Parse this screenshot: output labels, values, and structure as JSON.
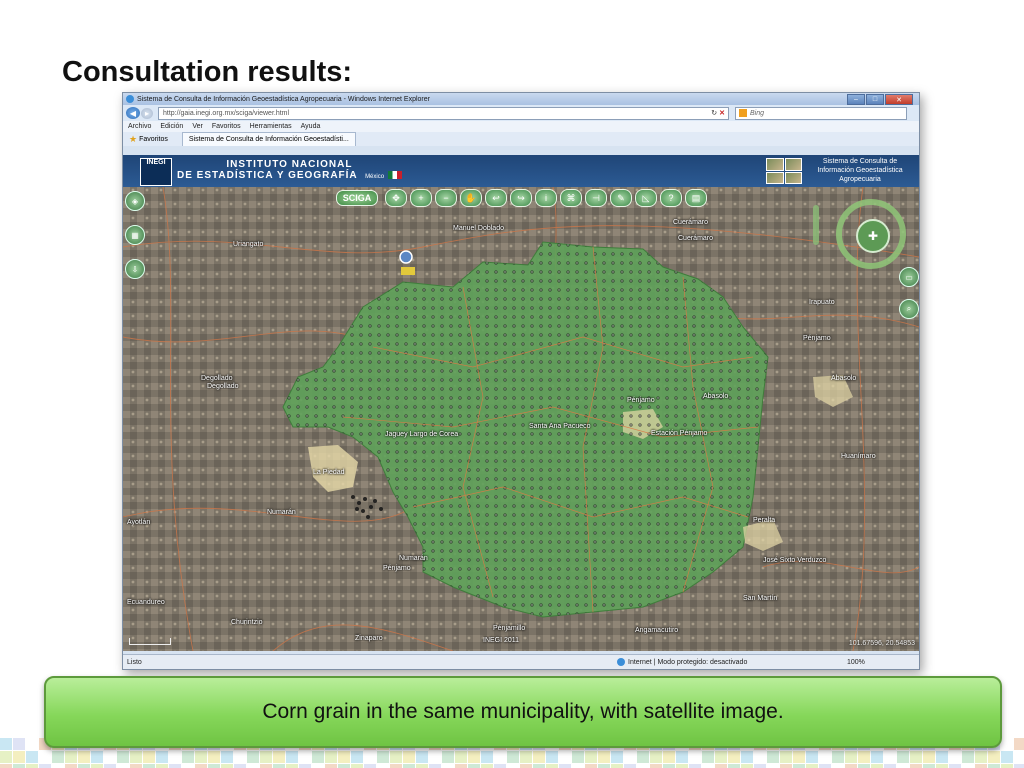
{
  "slide": {
    "title": "Consultation results:",
    "caption": "Corn grain in the same municipality, with satellite image."
  },
  "browser": {
    "window_title": "Sistema de Consulta de Información Geoestadística Agropecuaria - Windows Internet Explorer",
    "url": "http://gaia.inegi.org.mx/sciga/viewer.html",
    "search_placeholder": "Bing",
    "menu": [
      "Archivo",
      "Edición",
      "Ver",
      "Favoritos",
      "Herramientas",
      "Ayuda"
    ],
    "favorites_label": "Favoritos",
    "tab_label": "Sistema de Consulta de Información Geoestadísti...",
    "status_text": "Listo",
    "zone_text": "Internet | Modo protegido: desactivado",
    "zoom_text": "100%"
  },
  "app": {
    "logo_text": "INEGI",
    "institute_line1": "INSTITUTO NACIONAL",
    "institute_line2": "DE ESTADÍSTICA Y GEOGRAFÍA",
    "country": "México",
    "system_name_line1": "Sistema de Consulta de",
    "system_name_line2": "Información Geoestadística",
    "system_name_line3": "Agropecuaria",
    "toolbar_label": "SCIGA"
  },
  "map": {
    "places": [
      "Manuel Doblado",
      "Cuerámaro",
      "Cuerámaro",
      "Uriangato",
      "Pénjamo",
      "Abasolo",
      "Abasolo",
      "Pénjamo",
      "Estación Pénjamo",
      "Jaguey Largo de Corea",
      "Santa Ana Pacueco",
      "La Piedad",
      "Numarán",
      "Numarán",
      "Pénjamo",
      "Ayotlán",
      "Irapuato",
      "Huanímaro",
      "Peralta",
      "José Sixto Verduzco",
      "San Martín",
      "Pénjamillo",
      "Angamacutiro",
      "Churintzio",
      "Zinaparo",
      "Ecuandureo",
      "Degollado",
      "Degollado"
    ],
    "coordinates": "101.67596, 20.54853",
    "copyright": "INEGI 2011"
  },
  "colors": {
    "crop_area": "#5fa25a",
    "caption_green": "#86d75a",
    "header_blue": "#1f4577"
  }
}
